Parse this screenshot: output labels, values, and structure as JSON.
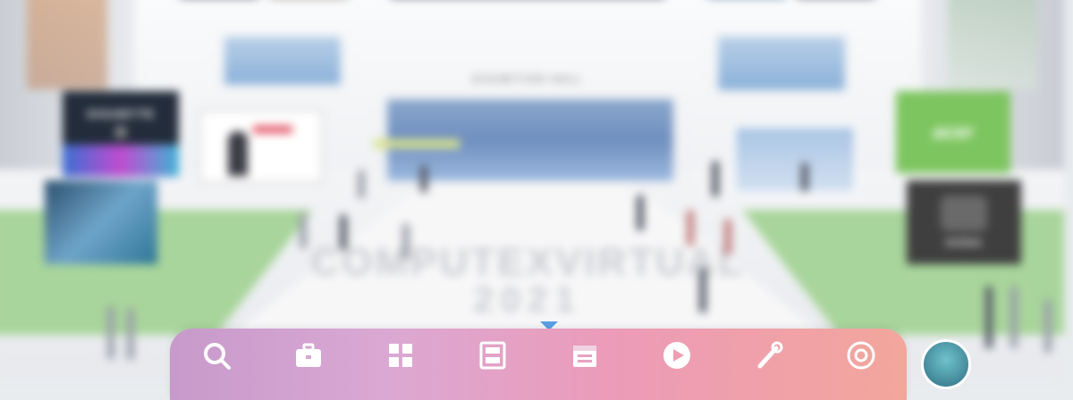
{
  "scene": {
    "hall_label": "EXHIBITION HALL",
    "floor_text": [
      "COMPUTEXVIRTUAL",
      "2021"
    ],
    "brands": {
      "left_top": "GIGABYTE",
      "right_top": "acer",
      "right_bottom": "NVIDIA"
    }
  },
  "toolbar": {
    "items": [
      {
        "icon": "search-icon",
        "label": ""
      },
      {
        "icon": "briefcase-icon",
        "label": ""
      },
      {
        "icon": "grid-icon",
        "label": ""
      },
      {
        "icon": "layout-icon",
        "label": ""
      },
      {
        "icon": "calendar-icon",
        "label": ""
      },
      {
        "icon": "play-icon",
        "label": ""
      },
      {
        "icon": "tools-icon",
        "label": ""
      },
      {
        "icon": "globe-icon",
        "label": ""
      }
    ],
    "colors": [
      "#c79acb",
      "#dba8d3",
      "#ec9bb8",
      "#f2a69b"
    ]
  }
}
